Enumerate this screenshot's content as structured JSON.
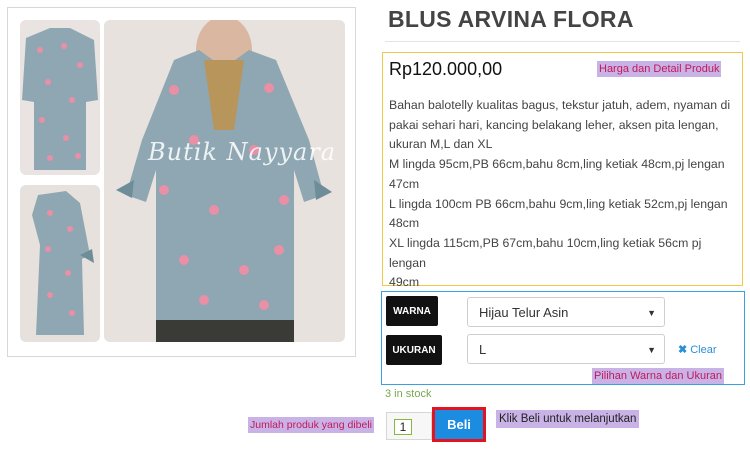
{
  "product": {
    "title": "BLUS ARVINA FLORA",
    "price": "Rp120.000,00",
    "watermark": "Butik Nayyara",
    "description_lines": [
      "Bahan balotelly kualitas bagus, tekstur jatuh, adem, nyaman di",
      "pakai sehari hari, kancing belakang leher, aksen pita lengan,",
      "ukuran M,L dan XL",
      "M lingda 95cm,PB 66cm,bahu 8cm,ling ketiak 48cm,pj lengan",
      "47cm",
      "L lingda 100cm PB 66cm,bahu 9cm,ling ketiak 52cm,pj lengan",
      "48cm",
      "XL lingda 115cm,PB 67cm,bahu 10cm,ling ketiak 56cm pj lengan",
      "49cm"
    ]
  },
  "variants": {
    "color_label": "WARNA",
    "color_value": "Hijau Telur Asin",
    "size_label": "UKURAN",
    "size_value": "L",
    "clear_label": "Clear"
  },
  "stock_text": "3 in stock",
  "cart": {
    "quantity": "1",
    "buy_label": "Beli"
  },
  "annotations": {
    "price_detail": "Harga dan Detail Produk",
    "variant_choice": "Pilihan Warna dan Ukuran",
    "quantity_hint": "Jumlah produk yang dibeli",
    "buy_hint": "Klik Beli untuk melanjutkan"
  },
  "colors": {
    "price_border": "#f0c84a",
    "variant_border": "#3aa0de",
    "buy_button": "#1b8ce0",
    "buy_outline": "#e3141f",
    "stock_text": "#7aa84e",
    "annotation_bg": "#c9b3e6"
  },
  "icons": {
    "clear": "close-x-icon",
    "select_arrow": "caret-down-icon"
  }
}
